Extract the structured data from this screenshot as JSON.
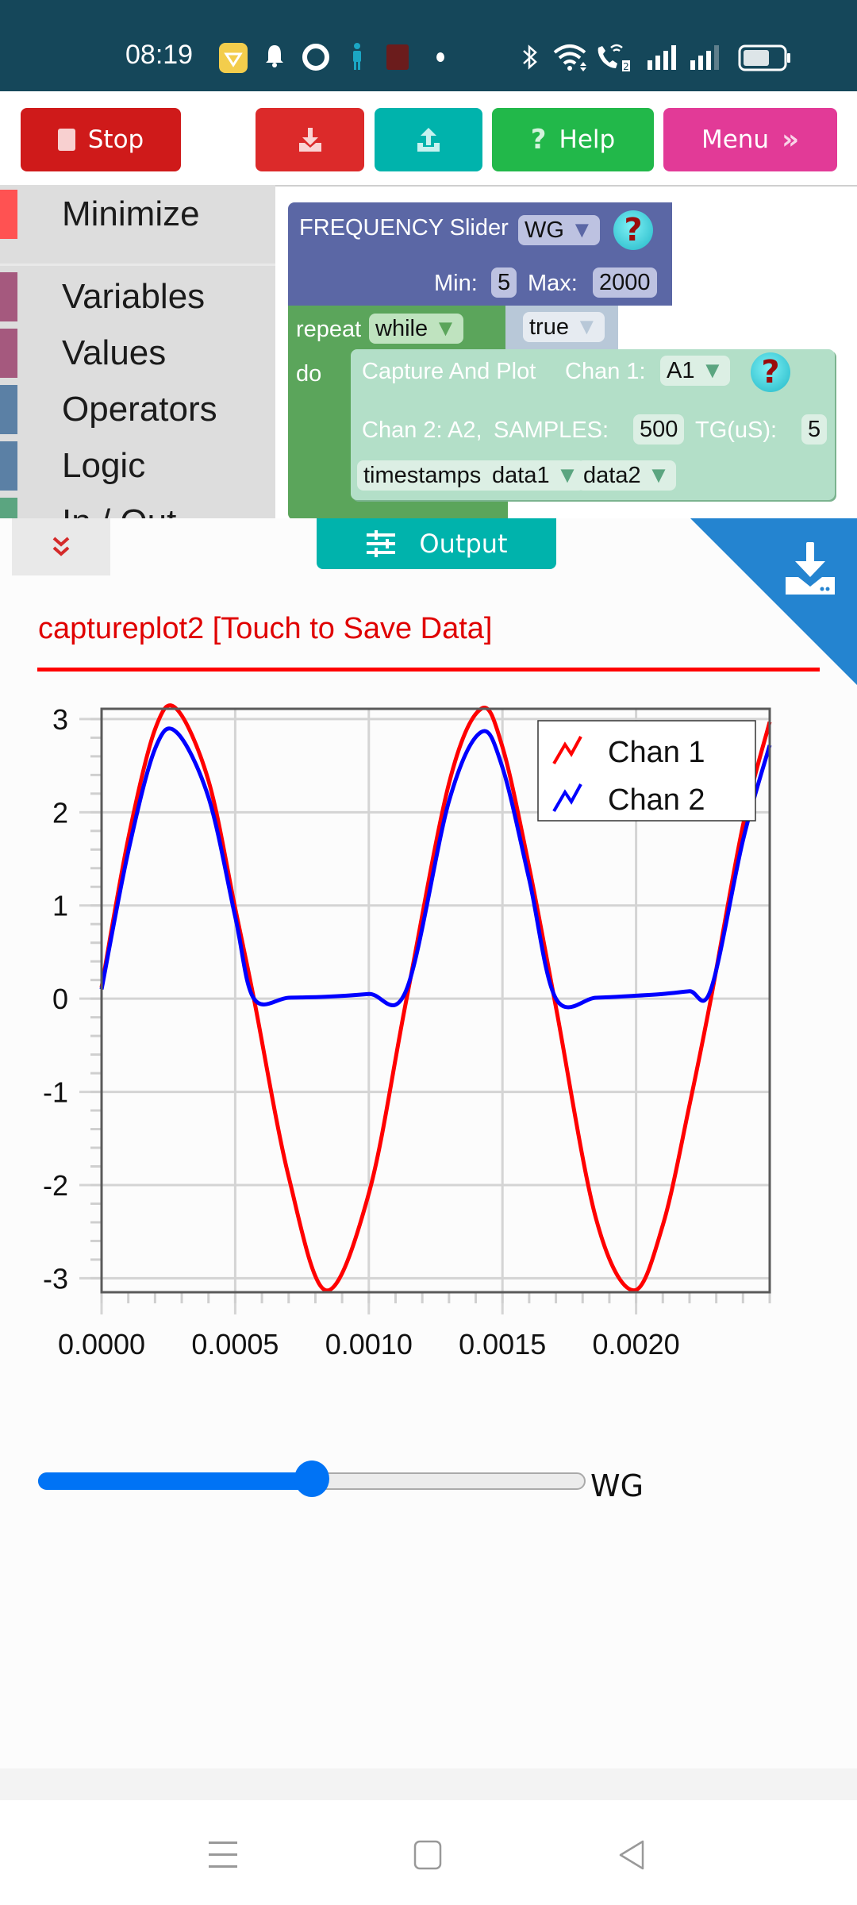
{
  "status_bar": {
    "time": "08:19",
    "icons": [
      "vpn-diamond-icon",
      "bell-icon",
      "ring-icon",
      "person-icon",
      "app-badge-icon",
      "dot-icon",
      "bluetooth-icon",
      "wifi-icon",
      "wifi-calling-icon",
      "signal-1-icon",
      "signal-2-icon",
      "battery-icon"
    ],
    "wifi_calling_badge": "2"
  },
  "toolbar": {
    "stop_label": "Stop",
    "download_label": "",
    "upload_label": "",
    "help_label": "Help",
    "menu_label": "Menu",
    "colors": {
      "stop": "#cf1a1a",
      "download": "#dc2a2a",
      "upload": "#00b3ac",
      "help": "#22b84a",
      "menu": "#e23a97"
    }
  },
  "toolbox": {
    "items": [
      {
        "label": "Minimize",
        "color": "#ff5252"
      },
      {
        "label": "Variables",
        "color": "#a5597e"
      },
      {
        "label": "Values",
        "color": "#a5597e"
      },
      {
        "label": "Operators",
        "color": "#5b80a5"
      },
      {
        "label": "Logic",
        "color": "#5b80a5"
      },
      {
        "label": "In / Out",
        "color": "#5ba580"
      }
    ]
  },
  "workspace": {
    "freq_block": {
      "title": "FREQUENCY Slider",
      "dropdown": "WG",
      "min_label": "Min:",
      "min_value": "5",
      "max_label": "Max:",
      "max_value": "2000",
      "help": "?"
    },
    "repeat_block": {
      "repeat_label": "repeat",
      "mode": "while",
      "condition": "true",
      "do_label": "do"
    },
    "capture_block": {
      "title": "Capture And Plot",
      "chan1_label": "Chan 1:",
      "chan1_value": "A1",
      "chan2_text": "Chan 2: A2,",
      "samples_label": "SAMPLES:",
      "samples_value": "500",
      "tg_label": "TG(uS):",
      "tg_value": "5",
      "var1": "timestamps",
      "var2": "data1",
      "var3": "data2",
      "help": "?"
    }
  },
  "output": {
    "tab_label": "Output",
    "plot_title": "captureplot2 [Touch to Save Data]",
    "slider": {
      "label": "WG",
      "min": 5,
      "max": 2000,
      "fraction": 0.5
    }
  },
  "chart_data": {
    "type": "line",
    "title": "captureplot2 [Touch to Save Data]",
    "xlabel": "",
    "ylabel": "",
    "xlim": [
      0,
      0.0025
    ],
    "ylim": [
      -3.15,
      3.11
    ],
    "grid": true,
    "legend_position": "top-right",
    "x_ticks": [
      "0.0000",
      "0.0005",
      "0.0010",
      "0.0015",
      "0.0020"
    ],
    "x_tick_values": [
      0,
      0.0005,
      0.001,
      0.0015,
      0.002
    ],
    "y_ticks": [
      "3",
      "2",
      "1",
      "0",
      "-1",
      "-2",
      "-3"
    ],
    "y_tick_values": [
      3,
      2,
      1,
      0,
      -1,
      -2,
      -3
    ],
    "series": [
      {
        "name": "Chan 1",
        "color": "#ff0000",
        "description": "sine wave ~876 Hz, amplitude ~3.13, clipped at ~3.11",
        "x": [
          0,
          0.0001,
          0.0002,
          0.00028,
          0.0004,
          0.0005,
          0.00057,
          0.0007,
          0.00084,
          0.001,
          0.00114,
          0.0013,
          0.00142,
          0.0015,
          0.0016,
          0.0017,
          0.00185,
          0.00199,
          0.0021,
          0.0022,
          0.00228,
          0.0024,
          0.0025
        ],
        "y": [
          0.12,
          1.72,
          2.89,
          3.11,
          2.34,
          0.97,
          0.0,
          -1.91,
          -3.13,
          -2.09,
          -0.02,
          2.31,
          3.11,
          2.7,
          1.41,
          -0.09,
          -2.36,
          -3.13,
          -2.43,
          -1.14,
          0.0,
          1.86,
          2.97
        ]
      },
      {
        "name": "Chan 2",
        "color": "#0000ff",
        "description": "half-wave rectified version of Chan 1, peak ~2.86, flat ~0.0-0.1 when negative",
        "x": [
          0,
          0.0001,
          0.0002,
          0.00028,
          0.0004,
          0.0005,
          0.00057,
          0.0007,
          0.00084,
          0.001,
          0.00114,
          0.0013,
          0.00142,
          0.0015,
          0.0016,
          0.0017,
          0.00185,
          0.00199,
          0.0021,
          0.0022,
          0.00228,
          0.0024,
          0.0025
        ],
        "y": [
          0.1,
          1.58,
          2.68,
          2.86,
          2.16,
          0.88,
          0.0,
          0.01,
          0.02,
          0.05,
          0.09,
          2.12,
          2.86,
          2.48,
          1.28,
          0.0,
          0.01,
          0.03,
          0.05,
          0.08,
          0.1,
          1.7,
          2.72
        ]
      }
    ]
  },
  "nav_bar": {
    "buttons": [
      "recents-icon",
      "home-icon",
      "back-icon"
    ]
  }
}
